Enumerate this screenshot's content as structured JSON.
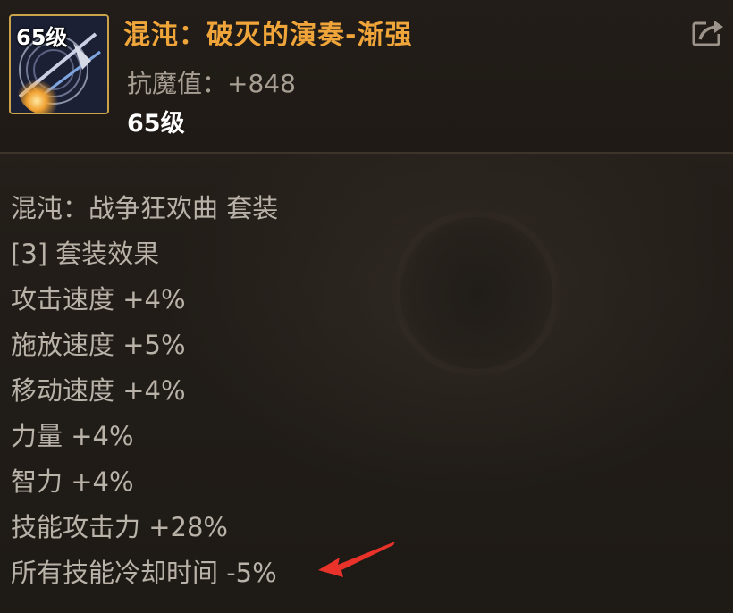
{
  "item": {
    "icon_level": "65级",
    "name": "混沌：破灭的演奏-渐强",
    "stat_label": "抗魔值：",
    "stat_value": "+848",
    "level": "65级"
  },
  "set": {
    "name": "混沌：战争狂欢曲  套装",
    "effect_header": "[3] 套装效果",
    "effects": [
      "攻击速度 +4%",
      "施放速度 +5%",
      "移动速度 +4%",
      "力量 +4%",
      "智力 +4%",
      "技能攻击力 +28%",
      "所有技能冷却时间 -5%"
    ]
  },
  "icons": {
    "share": "share-icon",
    "item": "item-icon",
    "annotation": "red-arrow-icon"
  },
  "colors": {
    "item_name": "#f0a53a",
    "icon_border": "#c9a24a",
    "annotation_arrow": "#e8322a"
  }
}
